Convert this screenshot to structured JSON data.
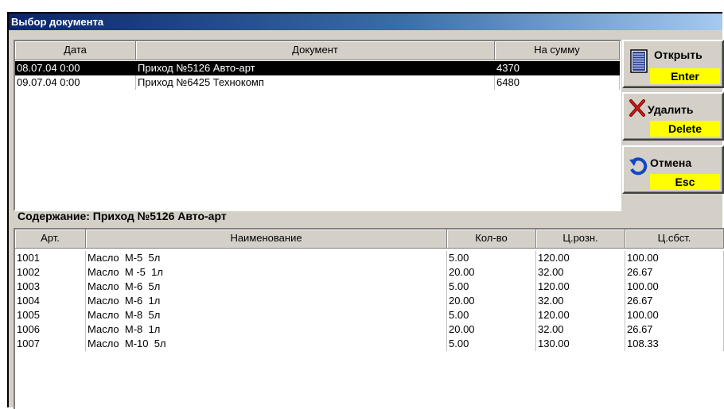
{
  "window": {
    "title": "Выбор документа"
  },
  "documents": {
    "columns": [
      "Дата",
      "Документ",
      "На сумму"
    ],
    "rows": [
      {
        "date": "08.07.04 0:00",
        "document": "Приход №5126 Авто-арт",
        "sum": "4370",
        "selected": true
      },
      {
        "date": "09.07.04 0:00",
        "document": "Приход №6425 Технокомп",
        "sum": "6480",
        "selected": false
      }
    ]
  },
  "buttons": {
    "open": {
      "label": "Открыть",
      "key": "Enter",
      "icon": "document-list-icon"
    },
    "delete": {
      "label": "Удалить",
      "key": "Delete",
      "icon": "red-x-icon"
    },
    "cancel": {
      "label": "Отмена",
      "key": "Esc",
      "icon": "undo-arrow-icon"
    }
  },
  "contents": {
    "label": "Содержание: Приход №5126 Авто-арт",
    "columns": [
      "Арт.",
      "Наименование",
      "Кол-во",
      "Ц.розн.",
      "Ц.сбст."
    ],
    "rows": [
      {
        "art": "1001",
        "name": "Масло  М-5  5л",
        "qty": "5.00",
        "retail": "120.00",
        "cost": "100.00"
      },
      {
        "art": "1002",
        "name": "Масло  М -5  1л",
        "qty": "20.00",
        "retail": "32.00",
        "cost": "26.67"
      },
      {
        "art": "1003",
        "name": "Масло  М-6  5л",
        "qty": "5.00",
        "retail": "120.00",
        "cost": "100.00"
      },
      {
        "art": "1004",
        "name": "Масло  М-6  1л",
        "qty": "20.00",
        "retail": "32.00",
        "cost": "26.67"
      },
      {
        "art": "1005",
        "name": "Масло  М-8  5л",
        "qty": "5.00",
        "retail": "120.00",
        "cost": "100.00"
      },
      {
        "art": "1006",
        "name": "Масло  М-8  1л",
        "qty": "20.00",
        "retail": "32.00",
        "cost": "26.67"
      },
      {
        "art": "1007",
        "name": "Масло  М-10  5л",
        "qty": "5.00",
        "retail": "130.00",
        "cost": "108.33"
      }
    ]
  }
}
